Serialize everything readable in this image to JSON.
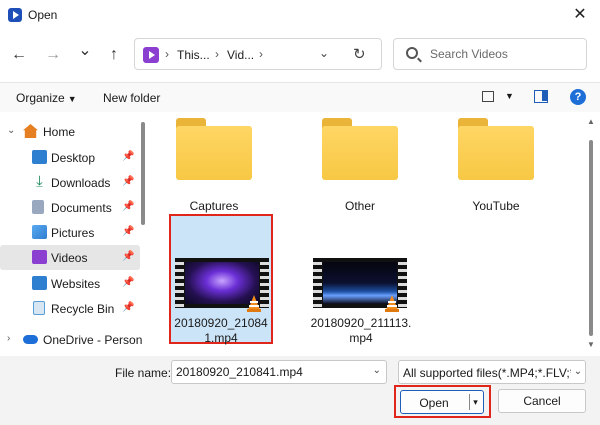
{
  "window": {
    "title": "Open",
    "close_glyph": "✕"
  },
  "nav": {
    "back_glyph": "←",
    "forward_glyph": "→",
    "recent_glyph": "⌄",
    "up_glyph": "↑",
    "address": {
      "sep1": "›",
      "seg1": "This...",
      "sep2": "›",
      "seg2": "Vid...",
      "sep3": "›",
      "dropdown_glyph": "⌄",
      "refresh_glyph": "↻"
    },
    "search_placeholder": "Search Videos"
  },
  "commandbar": {
    "organize_label": "Organize",
    "new_folder_label": "New folder",
    "help_label": "?"
  },
  "sidebar": {
    "items": [
      {
        "label": "Home",
        "chevron": "⌄",
        "icon": "home-icon",
        "color": "#e67e22"
      },
      {
        "label": "Desktop",
        "icon": "desktop-icon",
        "color": "#2f7fd1",
        "pinned": true
      },
      {
        "label": "Downloads",
        "icon": "downloads-icon",
        "color": "#1f8a5b",
        "pinned": true
      },
      {
        "label": "Documents",
        "icon": "documents-icon",
        "color": "#7a8ca8",
        "pinned": true
      },
      {
        "label": "Pictures",
        "icon": "pictures-icon",
        "color": "#2f7fd1",
        "pinned": true
      },
      {
        "label": "Videos",
        "icon": "videos-icon",
        "color": "#8a3fd1",
        "pinned": true,
        "selected": true
      },
      {
        "label": "Websites",
        "icon": "websites-icon",
        "color": "#2f7fd1",
        "pinned": true
      },
      {
        "label": "Recycle Bin",
        "icon": "recycle-bin-icon",
        "color": "#5a9fd6",
        "pinned": true
      },
      {
        "label": "OneDrive - Person",
        "chevron": "›",
        "icon": "onedrive-icon",
        "color": "#1e6ed8"
      }
    ],
    "pin_glyph": "📌"
  },
  "files": [
    {
      "name": "Captures",
      "type": "folder"
    },
    {
      "name": "Other",
      "type": "folder"
    },
    {
      "name": "YouTube",
      "type": "folder"
    },
    {
      "name": "20180920_210841.mp4",
      "type": "video",
      "selected": true
    },
    {
      "name": "20180920_211113.mp4",
      "type": "video"
    }
  ],
  "footer": {
    "file_name_label": "File name:",
    "file_name_value": "20180920_210841.mp4",
    "filter_text": "All supported files(*.MP4;*.FLV;*",
    "open_label": "Open",
    "cancel_label": "Cancel",
    "dropdown_glyph": "⌄",
    "split_glyph": "▾"
  },
  "colors": {
    "accent": "#1e5eb8",
    "highlight_red": "#e0261b",
    "selection_bg": "#cce4f7",
    "folder": "#ffd664"
  }
}
